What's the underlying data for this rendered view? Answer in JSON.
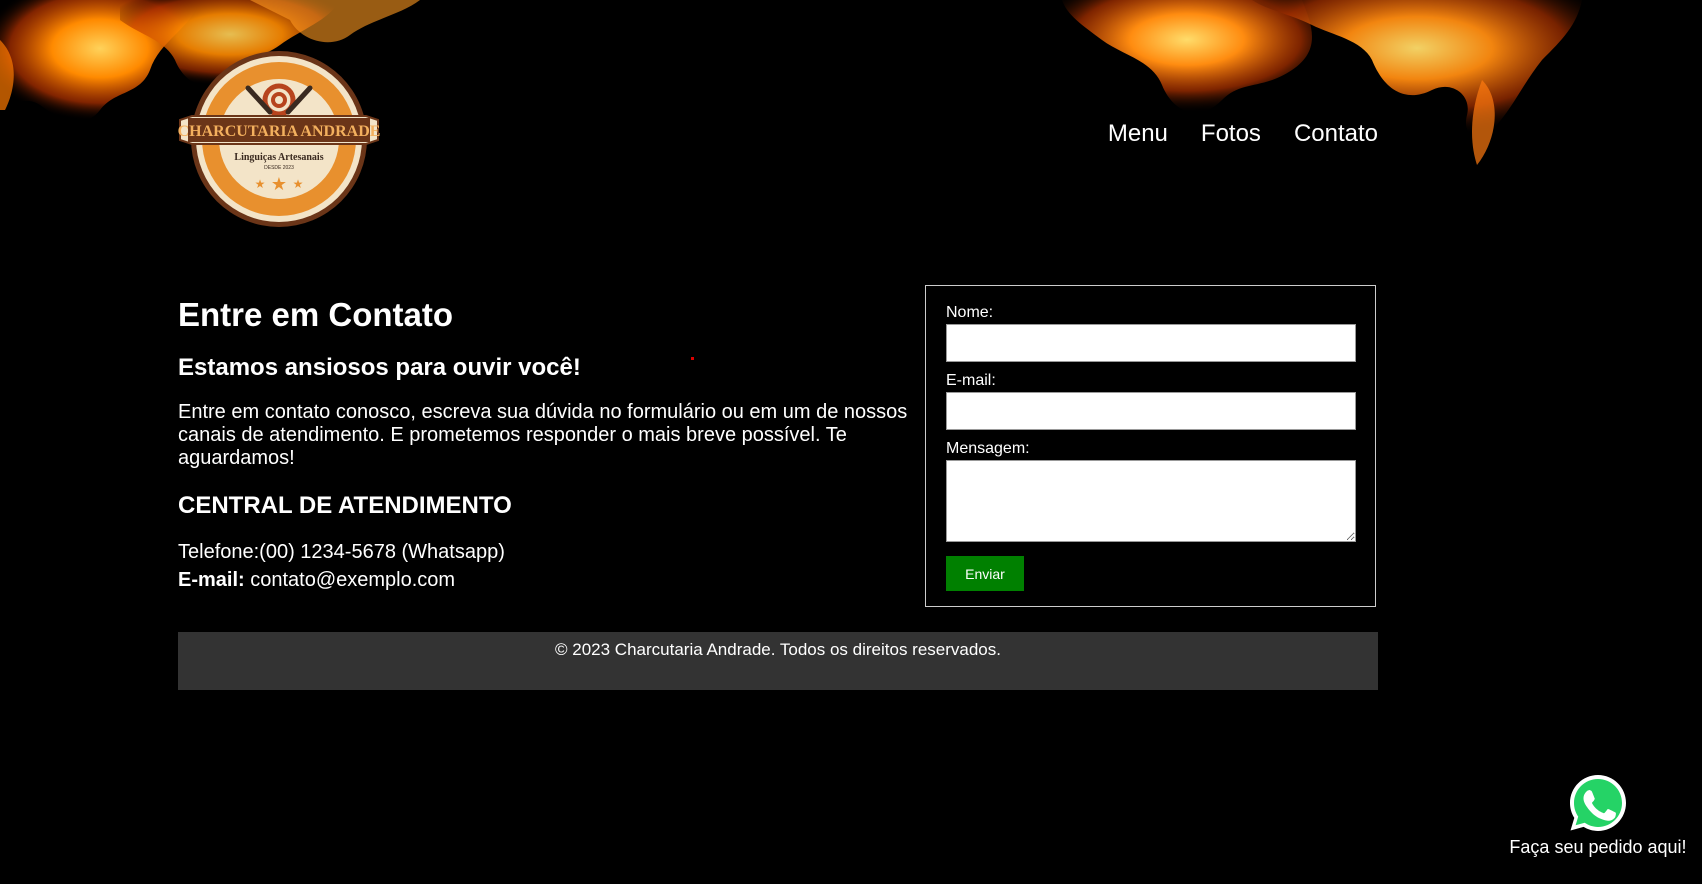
{
  "brand": {
    "name": "CHARCUTARIA ANDRADE",
    "tagline": "Linguiças Artesanais",
    "since": "DESDE 2023"
  },
  "nav": {
    "items": [
      {
        "label": "Menu"
      },
      {
        "label": "Fotos"
      },
      {
        "label": "Contato"
      }
    ]
  },
  "contact": {
    "title": "Entre em Contato",
    "subtitle": "Estamos ansiosos para ouvir você!",
    "description": "Entre em contato conosco, escreva sua dúvida no formulário ou em um de nossos canais de atendimento. E prometemos responder o mais breve possível. Te aguardamos!",
    "central_title": "CENTRAL DE ATENDIMENTO",
    "phone": "Telefone:(00) 1234-5678 (Whatsapp)",
    "email_label": "E-mail:",
    "email_value": " contato@exemplo.com"
  },
  "form": {
    "name_label": "Nome:",
    "name_value": "",
    "email_label": "E-mail:",
    "email_value": "",
    "message_label": "Mensagem:",
    "message_value": "",
    "submit_label": "Enviar"
  },
  "footer": {
    "text": "© 2023 Charcutaria Andrade. Todos os direitos reservados."
  },
  "whatsapp": {
    "label": "Faça seu pedido aqui!",
    "icon": "whatsapp-icon"
  },
  "colors": {
    "background": "#000000",
    "submit_button": "#008000",
    "footer_bg": "#333333",
    "whatsapp_green": "#25D366",
    "logo_orange": "#E8902E"
  }
}
